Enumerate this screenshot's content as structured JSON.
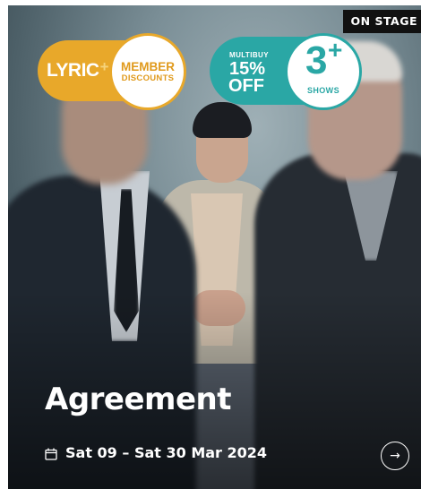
{
  "badge_label": "ON STAGE",
  "promo_member": {
    "brand": "LYRIC",
    "brand_plus": "+",
    "line1": "MEMBER",
    "line2": "DISCOUNTS",
    "color": "#e8a82a"
  },
  "promo_multibuy": {
    "small": "MULTIBUY",
    "percent": "15%",
    "off": "OFF",
    "count": "3",
    "count_plus": "+",
    "unit": "SHOWS",
    "color": "#2aa7a5"
  },
  "show": {
    "title": "Agreement",
    "dates": "Sat 09 – Sat 30 Mar 2024"
  },
  "icons": {
    "calendar": "calendar-icon",
    "arrow": "arrow-right-icon"
  },
  "arrow_glyph": "→"
}
